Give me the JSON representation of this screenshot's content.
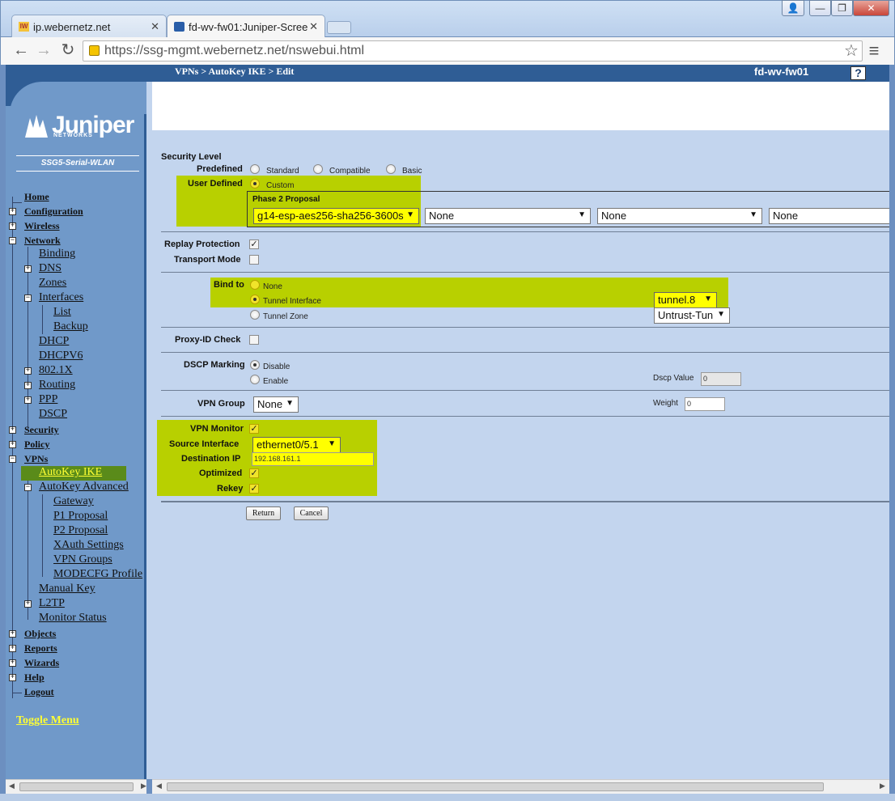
{
  "browser": {
    "tabs": [
      {
        "label": "ip.webernetz.net",
        "favicon": "IW"
      },
      {
        "label": "fd-wv-fw01:Juniper-Scree"
      }
    ],
    "url_host": "https://ssg-mgmt.webernetz.net",
    "url_path": "/nswebui.html",
    "close_glyph": "✕",
    "win_min": "—",
    "win_max": "❐",
    "win_close": "✕",
    "user_glyph": "👤",
    "back_glyph": "←",
    "forward_glyph": "→",
    "reload_glyph": "↻",
    "star_glyph": "☆",
    "menu_glyph": "≡"
  },
  "header": {
    "breadcrumb": "VPNs > AutoKey IKE > Edit",
    "device": "fd-wv-fw01",
    "help": "?"
  },
  "sidebar": {
    "logo": "Juniper",
    "logo_sub": "NETWORKS",
    "model": "SSG5-Serial-WLAN",
    "toggle_menu": "Toggle Menu",
    "items": {
      "home": "Home",
      "configuration": "Configuration",
      "wireless": "Wireless",
      "network": "Network",
      "binding": "Binding",
      "dns": "DNS",
      "zones": "Zones",
      "interfaces": "Interfaces",
      "list": "List",
      "backup": "Backup",
      "dhcp": "DHCP",
      "dhcpv6": "DHCPV6",
      "8021x": "802.1X",
      "routing": "Routing",
      "ppp": "PPP",
      "dscp": "DSCP",
      "security": "Security",
      "policy": "Policy",
      "vpns": "VPNs",
      "autokey_ike": "AutoKey IKE",
      "autokey_advanced": "AutoKey Advanced",
      "gateway": "Gateway",
      "p1_proposal": "P1 Proposal",
      "p2_proposal": "P2 Proposal",
      "xauth_settings": "XAuth Settings",
      "vpn_groups": "VPN Groups",
      "modecfg_profile": "MODECFG Profile",
      "manual_key": "Manual Key",
      "l2tp": "L2TP",
      "monitor_status": "Monitor Status",
      "objects": "Objects",
      "reports": "Reports",
      "wizards": "Wizards",
      "help": "Help",
      "logout": "Logout"
    },
    "plus": "+",
    "minus": "−"
  },
  "form": {
    "security_level": "Security Level",
    "predefined": "Predefined",
    "standard": "Standard",
    "compatible": "Compatible",
    "basic": "Basic",
    "user_defined": "User Defined",
    "custom": "Custom",
    "phase2_proposal": "Phase 2 Proposal",
    "p2_1": "g14-esp-aes256-sha256-3600s",
    "p2_2": "None",
    "p2_3": "None",
    "p2_4": "None",
    "replay_protection": "Replay Protection",
    "transport_mode": "Transport Mode",
    "bind_to": "Bind to",
    "bind_none": "None",
    "tunnel_interface": "Tunnel Interface",
    "tunnel_interface_value": "tunnel.8",
    "tunnel_zone": "Tunnel Zone",
    "tunnel_zone_value": "Untrust-Tun",
    "proxy_id_check": "Proxy-ID Check",
    "dscp_marking": "DSCP Marking",
    "disable": "Disable",
    "enable": "Enable",
    "dscp_value": "Dscp Value",
    "dscp_value_input": "0",
    "vpn_group": "VPN Group",
    "vpn_group_value": "None",
    "weight": "Weight",
    "weight_input": "0",
    "vpn_monitor": "VPN Monitor",
    "source_interface": "Source Interface",
    "source_interface_value": "ethernet0/5.1",
    "destination_ip": "Destination IP",
    "destination_ip_value": "192.168.161.1",
    "optimized": "Optimized",
    "rekey": "Rekey",
    "return": "Return",
    "cancel": "Cancel",
    "check_glyph": "✓",
    "dropdown_glyph": "▼"
  },
  "colors": {
    "header_bar": "#2f5d95",
    "sidebar": "#7099c9",
    "content": "#c3d5ee",
    "highlight": "#b8d000",
    "yellow_field": "#ffff00",
    "selected_nav": "#5a8b1a",
    "toggle_menu": "#ffff33"
  }
}
